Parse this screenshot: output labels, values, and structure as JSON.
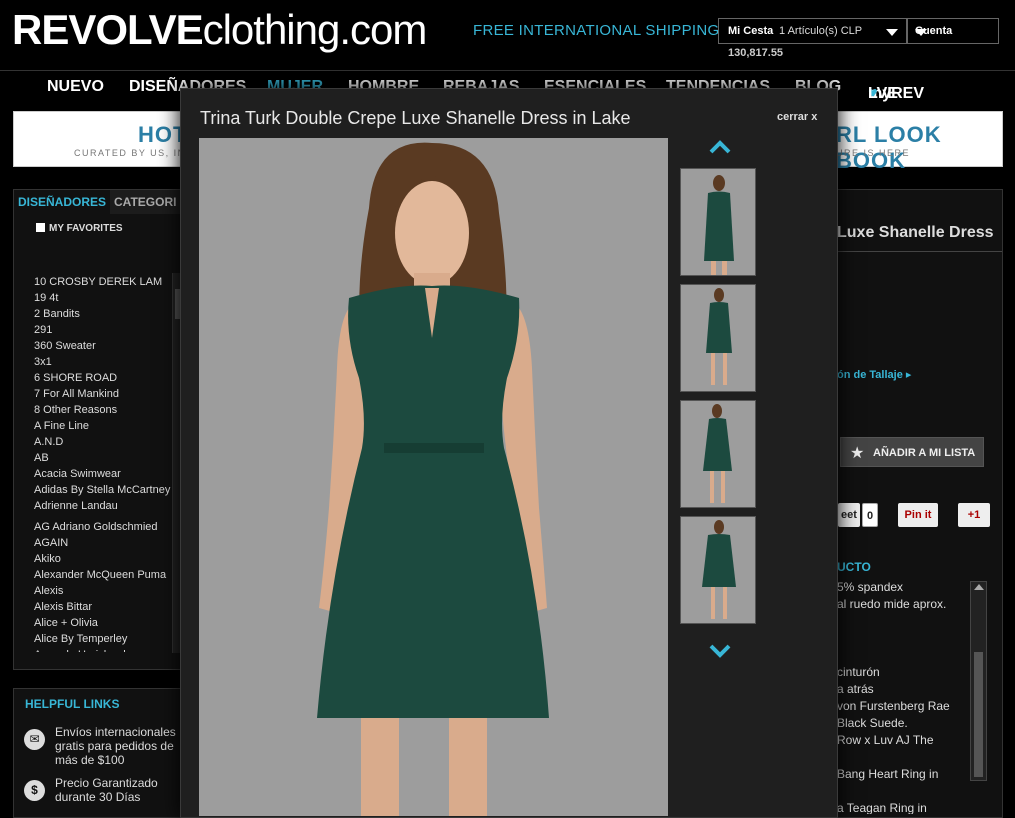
{
  "header": {
    "logo_bold": "REVOLVE",
    "logo_light": "clothing.com",
    "shipping": "FREE INTERNATIONAL SHIPPING",
    "cart_label": "Mi Cesta",
    "cart_items": "1 Artículo(s) CLP",
    "cart_amount": "130,817.55",
    "account_label": "Cuenta"
  },
  "nav": {
    "items": [
      "NUEVO",
      "DISEÑADORES",
      "MUJER",
      "HOMBRE",
      "REBAJAS",
      "ESENCIALES",
      "TENDENCIAS",
      "BLOG"
    ],
    "my_prefix": "myREV",
    "my_suffix": "LVE",
    "heart": "♥"
  },
  "banner": {
    "left_title": "HOTL",
    "left_sub": "CURATED BY US, IN",
    "right_title": "RL LOOK BOOK",
    "right_sub": "URE IS HERE"
  },
  "left_panel": {
    "tab_designers": "DISEÑADORES",
    "tab_categories": "CATEGORI",
    "favorites": "MY FAVORITES",
    "designers": [
      "10 CROSBY DEREK LAM",
      "19 4t",
      "2 Bandits",
      "291",
      "360 Sweater",
      "3x1",
      "6 SHORE ROAD",
      "7 For All Mankind",
      "8 Other Reasons",
      "A Fine Line",
      "A.N.D",
      "AB",
      "Acacia Swimwear",
      "Adidas By Stella McCartney",
      "Adrienne Landau",
      "AG Adriano Goldschmied",
      "AGAIN",
      "Akiko",
      "Alexander McQueen Puma",
      "Alexis",
      "Alexis Bittar",
      "Alice + Olivia",
      "Alice By Temperley",
      "Amanda Uprichard"
    ]
  },
  "helpful_links": {
    "title": "HELPFUL LINKS",
    "items": [
      {
        "icon": "✉",
        "text": "Envíos internacionales gratis para pedidos de más de $100"
      },
      {
        "icon": "$",
        "text": "Precio Garantizado durante 30 Días"
      }
    ]
  },
  "product_panel": {
    "title_fragment": "Luxe Shanelle Dress",
    "size_link": "ón de Tallaje ▸",
    "wishlist_button": "AÑADIR A MI LISTA",
    "star": "★",
    "tweet": "eet",
    "tweet_count": "0",
    "pin": "Pin it",
    "gplus": "+1",
    "section_title": "UCTO",
    "description_lines": [
      "5% spandex",
      "al ruedo mide aprox.",
      "",
      "",
      "",
      "cinturón",
      "a atrás",
      "von Furstenberg Rae",
      "Black Suede.",
      "Row x Luv AJ The",
      "",
      "Bang Heart Ring in",
      "",
      "a Teagan Ring in"
    ]
  },
  "modal": {
    "title": "Trina Turk Double Crepe Luxe Shanelle Dress in Lake",
    "close": "cerrar x"
  },
  "colors": {
    "accent": "#38b6d6",
    "dress": "#1c4a3f",
    "photo_bg": "#9a9a9a"
  }
}
